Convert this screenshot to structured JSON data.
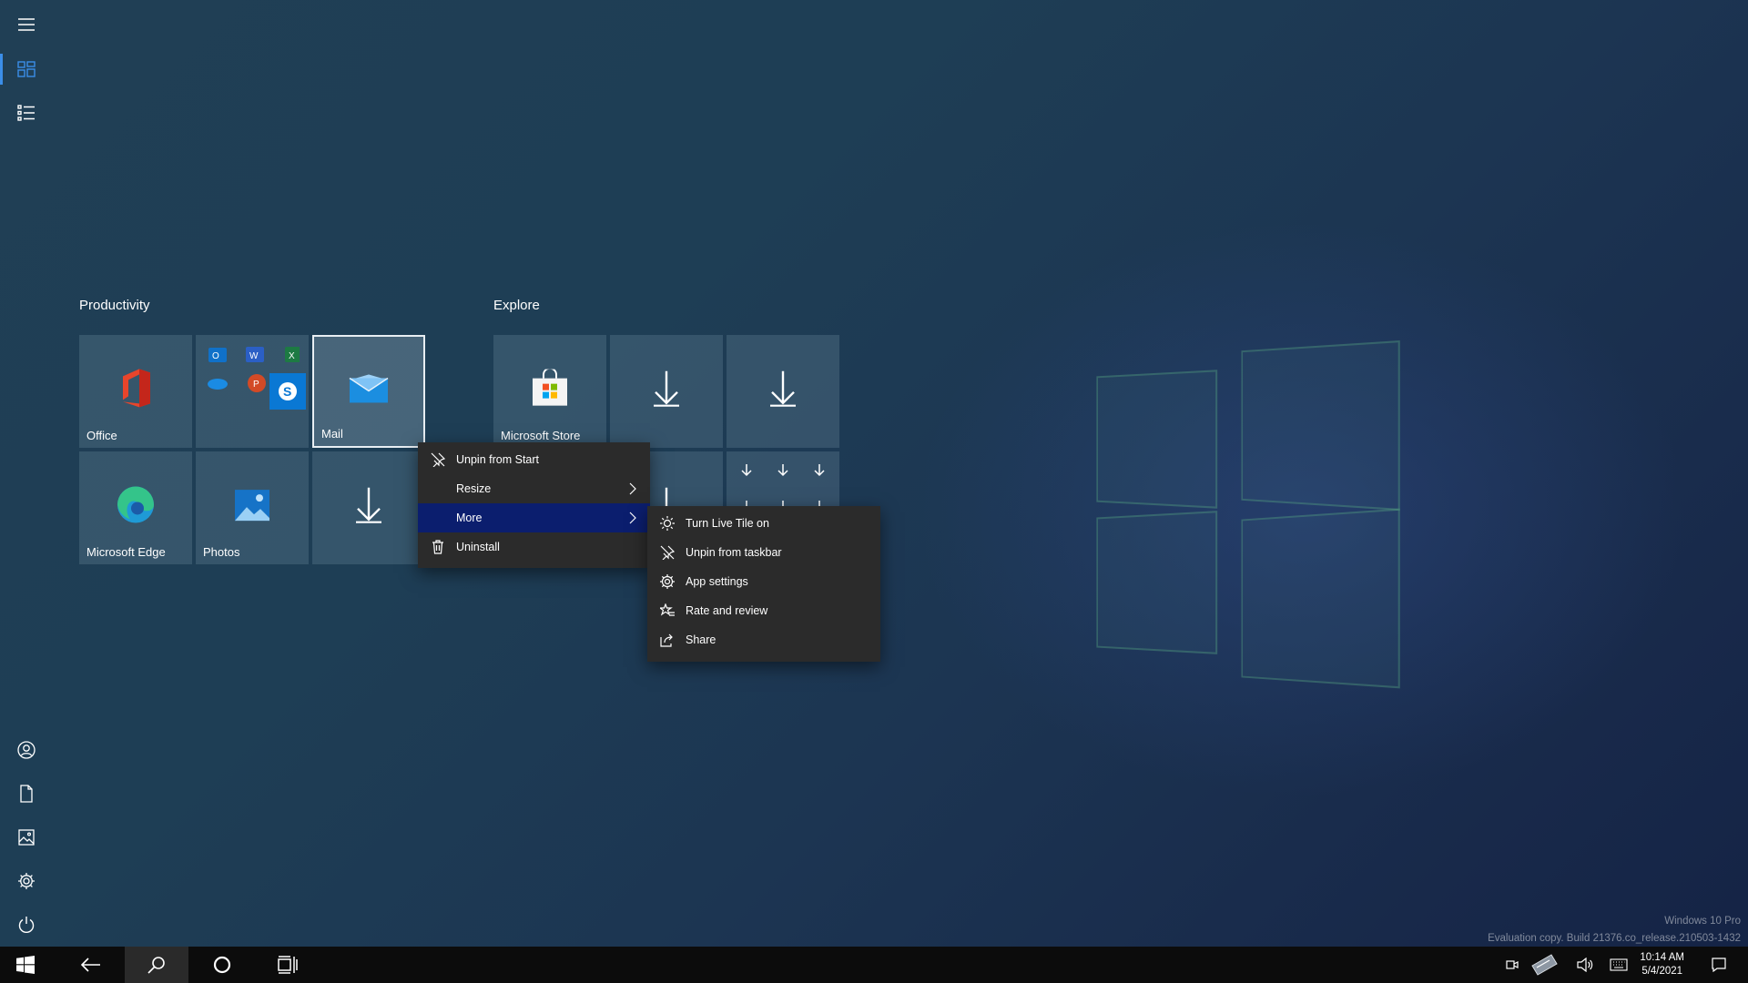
{
  "groups": {
    "productivity": {
      "title": "Productivity"
    },
    "explore": {
      "title": "Explore"
    }
  },
  "tiles": {
    "office": "Office",
    "mail": "Mail",
    "edge": "Microsoft Edge",
    "photos": "Photos",
    "store": "Microsoft Store"
  },
  "context_menu": {
    "items": [
      "Unpin from Start",
      "Resize",
      "More",
      "Uninstall"
    ]
  },
  "submenu": {
    "items": [
      "Turn Live Tile on",
      "Unpin from taskbar",
      "App settings",
      "Rate and review",
      "Share"
    ]
  },
  "taskbar": {
    "time": "10:14 AM",
    "date": "5/4/2021"
  },
  "watermark": {
    "edition": "Windows 10 Pro",
    "build": "Evaluation copy. Build 21376.co_release.210503-1432"
  },
  "colors": {
    "menu_highlight": "#0b1e6e",
    "accent": "#3b8ee8"
  }
}
